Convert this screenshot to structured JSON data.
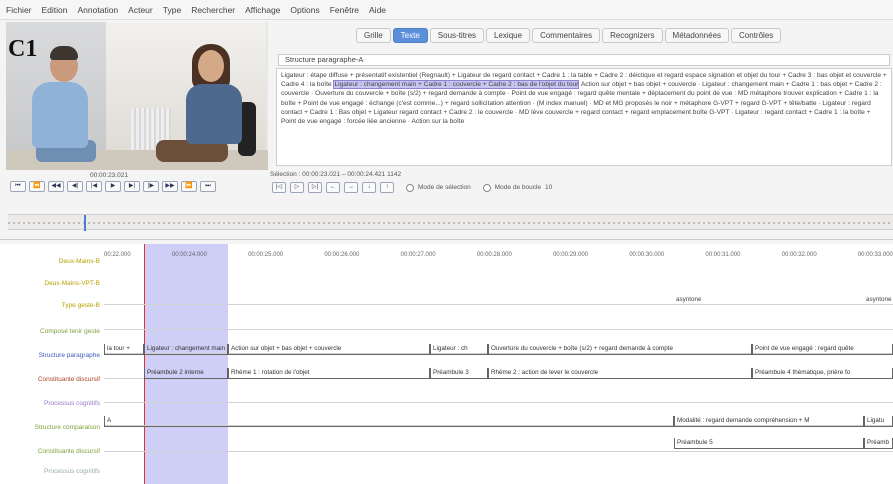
{
  "menu": [
    "Fichier",
    "Edition",
    "Annotation",
    "Acteur",
    "Type",
    "Rechercher",
    "Affichage",
    "Options",
    "Fenêtre",
    "Aide"
  ],
  "video": {
    "label": "C1",
    "timecode": "00:00:23.021"
  },
  "tabs": [
    "Grille",
    "Texte",
    "Sous-titres",
    "Lexique",
    "Commentaires",
    "Recognizers",
    "Métadonnées",
    "Contrôles"
  ],
  "active_tab": "Texte",
  "structure_select": "Structure paragraphe-A",
  "text_panel": {
    "before": "Ligateur : étape diffuse + présentatif existentiel (Regnault) + Ligateur de regard contact + Cadre 1 : la table + Cadre 2 : déictique et regard espace signation et objet du tour + Cadre 3 : bas objet et couvercle + Cadre 4 : la boîte",
    "highlight": "Ligateur : changement main + Cadre 1 : couvercle + Cadre 2 : bas de l'objet du tour",
    "after": "Action sur objet + bas objet + couvercle · Ligateur : changement main + Cadre 1 : bas objet + Cadre 2 : couvercle · Ouverture du couvercle + boîte (s/2) + regard demande à compte · Point de vue engagé : regard quête mentale + déplacement du point de vue : MD métaphore trouver explication + Cadre 1 : la boîte + Point de vue engagé : échange (c'est comme...) + regard sollicitation attention · (M index manuel) · MD et MG proposés le noir + métaphore G-VPT + regard G-VPT + tête/batte · Ligateur : regard contact + Cadre 1 : Bas objet + Ligateur regard contact + Cadre 2 : le couvercle · MD lève couvercle + regard contact + regard emplacement boîte G-VPT · Ligateur : regard contact + Cadre 1 : la boîte + Point de vue engagé : forcée liée ancienne · Action sur la boîte"
  },
  "selection_text": "Sélection : 00:00:23.021 – 00:00:24.421  1142",
  "controls_row2": {
    "mode_selection": "Mode de sélection",
    "mode_boucle": "Mode de boucle",
    "value": "10"
  },
  "timeline": {
    "ticks": [
      "00:22.000",
      "00:00:24.000",
      "00:00:25.000",
      "00:00:26.000",
      "00:00:27.000",
      "00:00:28.000",
      "00:00:29.000",
      "00:00:30.000",
      "00:00:31.000",
      "00:00:32.000",
      "00:00:33.000"
    ],
    "tiers": [
      "Deux-Mains-B",
      "Deux-Mains-VPT-B",
      "Type geste-B",
      "Composé tenir geste",
      "Structure paragraphe",
      "Constituante discursif",
      "Processus cognitifs",
      "Structure comparaison",
      "Constituante discursif",
      "Processus cognitifs"
    ],
    "asyntone": "asyntone",
    "row_paragraphe": [
      "la tour + ",
      "Ligateur : changement main",
      "Action sur objet + bas objet + couvercle",
      "Ligateur : ch",
      "Ouverture du couvercle + boîte (s/2) + regard demande à compte",
      "Point de vue engagé : regard quête"
    ],
    "row_constituant": [
      "Préambule 2 interne",
      "Rhème 1 : rotation de l'objet",
      "Préambule 3",
      "Rhème 2 : action de lever le couvercle",
      "Préambule 4 thématique, prière fo"
    ],
    "row_comparaison": [
      "A",
      "Modalité : regard demande compréhension + M",
      "Ligatu"
    ],
    "row_constituant2": [
      "Préambule 5",
      "Préamb"
    ]
  }
}
